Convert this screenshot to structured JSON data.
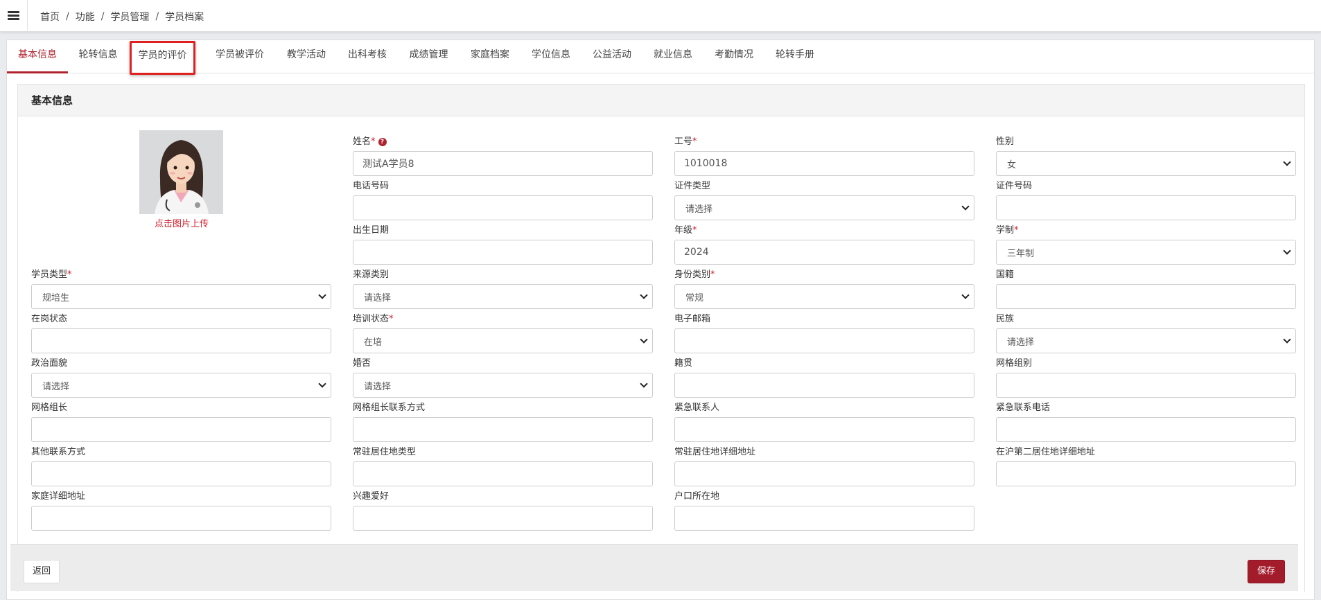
{
  "breadcrumb": {
    "items": [
      "首页",
      "功能",
      "学员管理",
      "学员档案"
    ]
  },
  "tabs": [
    {
      "label": "基本信息"
    },
    {
      "label": "轮转信息"
    },
    {
      "label": "学员的评价"
    },
    {
      "label": "学员被评价"
    },
    {
      "label": "教学活动"
    },
    {
      "label": "出科考核"
    },
    {
      "label": "成绩管理"
    },
    {
      "label": "家庭档案"
    },
    {
      "label": "学位信息"
    },
    {
      "label": "公益活动"
    },
    {
      "label": "就业信息"
    },
    {
      "label": "考勤情况"
    },
    {
      "label": "轮转手册"
    }
  ],
  "panel": {
    "title": "基本信息"
  },
  "avatar": {
    "upload_label": "点击图片上传"
  },
  "form": {
    "name": {
      "label": "姓名",
      "required": "*",
      "value": "测试A学员8"
    },
    "job_no": {
      "label": "工号",
      "required": "*",
      "value": "1010018"
    },
    "gender": {
      "label": "性别",
      "value": "女"
    },
    "phone": {
      "label": "电话号码",
      "value": ""
    },
    "id_type": {
      "label": "证件类型",
      "value": "请选择"
    },
    "id_no": {
      "label": "证件号码",
      "value": ""
    },
    "birth": {
      "label": "出生日期",
      "value": ""
    },
    "grade": {
      "label": "年级",
      "required": "*",
      "value": "2024"
    },
    "program": {
      "label": "学制",
      "required": "*",
      "value": "三年制"
    },
    "student_type": {
      "label": "学员类型",
      "required": "*",
      "value": "规培生"
    },
    "source_type": {
      "label": "来源类别",
      "value": "请选择"
    },
    "identity_type": {
      "label": "身份类别",
      "required": "*",
      "value": "常规"
    },
    "nationality": {
      "label": "国籍",
      "value": ""
    },
    "on_duty": {
      "label": "在岗状态",
      "value": ""
    },
    "training_status": {
      "label": "培训状态",
      "required": "*",
      "value": "在培"
    },
    "email": {
      "label": "电子邮箱",
      "value": ""
    },
    "ethnicity": {
      "label": "民族",
      "value": "请选择"
    },
    "political": {
      "label": "政治面貌",
      "value": "请选择"
    },
    "married": {
      "label": "婚否",
      "value": "请选择"
    },
    "native_place": {
      "label": "籍贯",
      "value": ""
    },
    "grid_group": {
      "label": "网格组别",
      "value": ""
    },
    "grid_leader": {
      "label": "网格组长",
      "value": ""
    },
    "grid_leader_contact": {
      "label": "网格组长联系方式",
      "value": ""
    },
    "emergency_contact": {
      "label": "紧急联系人",
      "value": ""
    },
    "emergency_phone": {
      "label": "紧急联系电话",
      "value": ""
    },
    "other_contact": {
      "label": "其他联系方式",
      "value": ""
    },
    "residence_type": {
      "label": "常驻居住地类型",
      "value": ""
    },
    "residence_addr": {
      "label": "常驻居住地详细地址",
      "value": ""
    },
    "second_addr": {
      "label": "在沪第二居住地详细地址",
      "value": ""
    },
    "home_addr": {
      "label": "家庭详细地址",
      "value": ""
    },
    "hobby": {
      "label": "兴趣爱好",
      "value": ""
    },
    "hukou": {
      "label": "户口所在地",
      "value": ""
    }
  },
  "footer": {
    "back_label": "返回",
    "save_label": "保存"
  },
  "colors": {
    "accent": "#a31c2b",
    "required": "#d41d2b",
    "highlight_outline": "#e02020"
  }
}
